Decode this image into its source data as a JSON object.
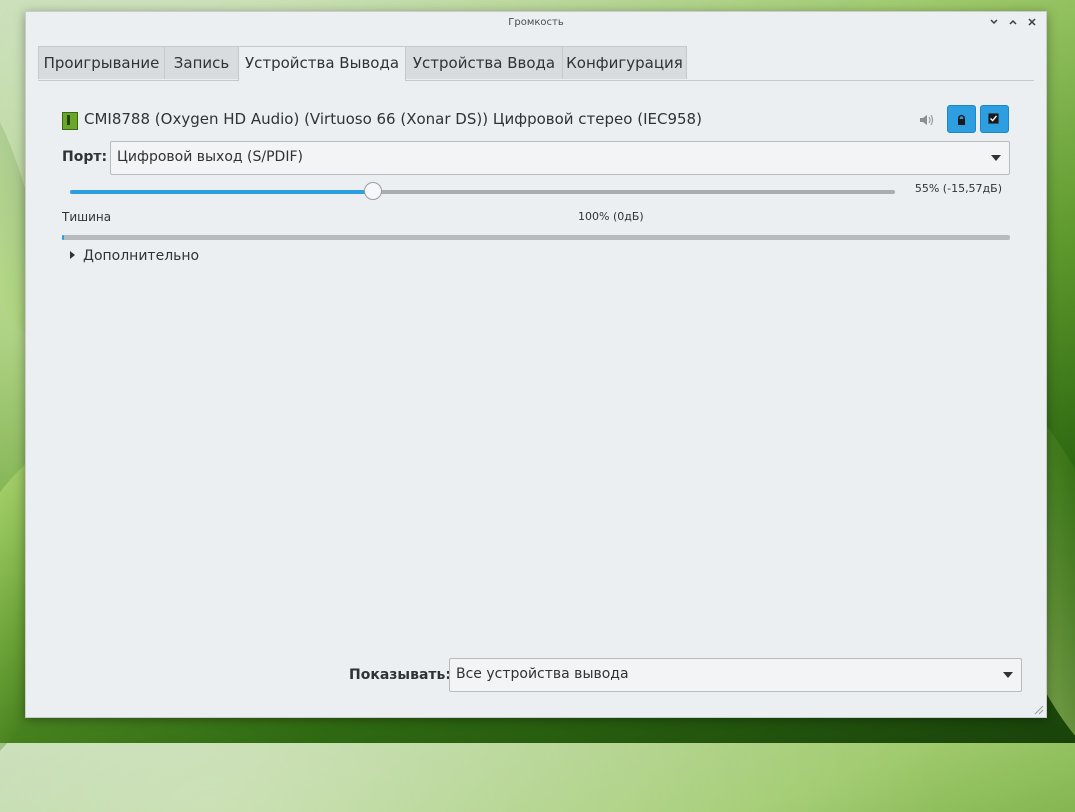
{
  "window": {
    "title": "Громкость",
    "controls": [
      "minimize-icon",
      "maximize-icon",
      "close-icon"
    ]
  },
  "tabs": [
    {
      "label": "Проигрывание",
      "active": false
    },
    {
      "label": "Запись",
      "active": false
    },
    {
      "label": "Устройства Вывода",
      "active": true
    },
    {
      "label": "Устройства Ввода",
      "active": false
    },
    {
      "label": "Конфигурация",
      "active": false
    }
  ],
  "device": {
    "name": "CMI8788 (Oxygen HD Audio) (Virtuoso 66 (Xonar DS)) Цифровой стерео (IEC958)",
    "icon": "sound-card-icon",
    "speaker_icon": "speaker-icon",
    "mute_icon": "lock-icon",
    "default_icon": "checkbox-icon",
    "port_label": "Порт:",
    "port_value": "Цифровой выход (S/PDIF)",
    "volume_percent": 55,
    "volume_text": "55% (-15,57дБ)",
    "scale_silence": "Тишина",
    "scale_full": "100% (0дБ)",
    "meter_level": 0.002,
    "advanced_label": "Дополнительно"
  },
  "footer": {
    "show_label": "Показывать:",
    "show_value": "Все устройства вывода"
  },
  "colors": {
    "accent": "#2d9fe0",
    "window_bg": "#eceff1",
    "device_icon": "#6aa629"
  }
}
